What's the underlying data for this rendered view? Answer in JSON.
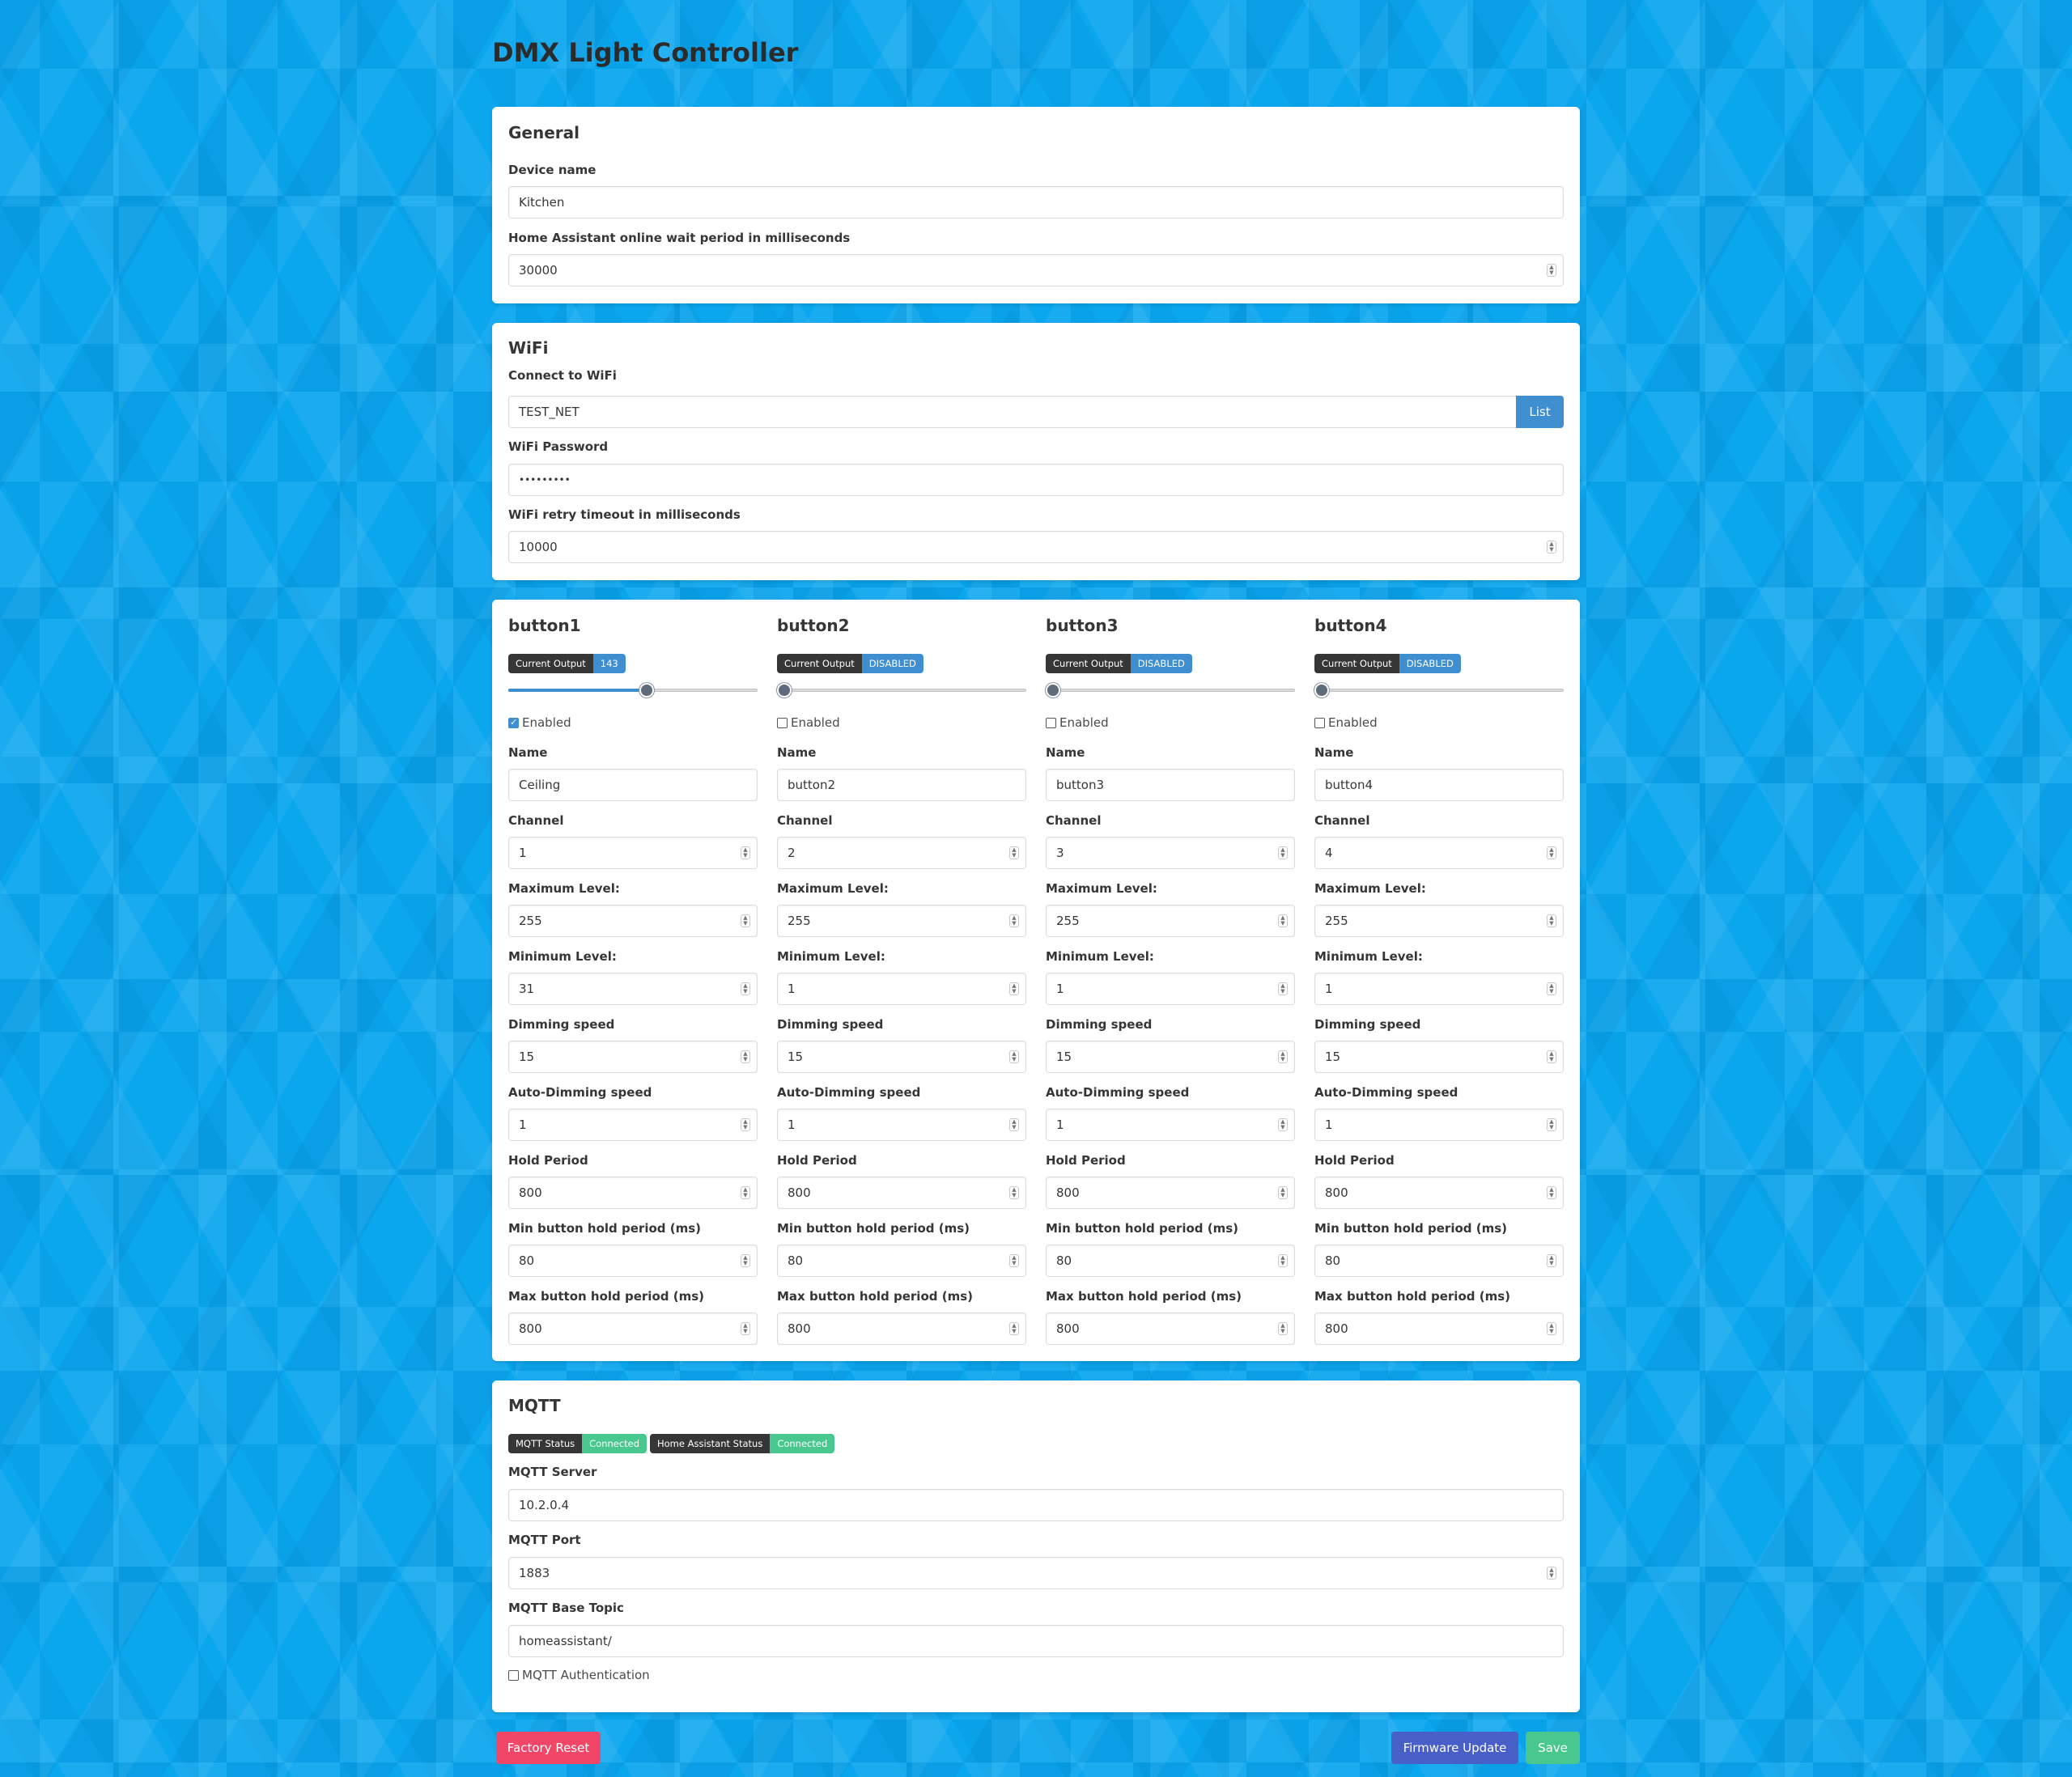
{
  "page_title": "DMX Light Controller",
  "general": {
    "title": "General",
    "device_name_label": "Device name",
    "device_name_value": "Kitchen",
    "ha_wait_label": "Home Assistant online wait period in milliseconds",
    "ha_wait_value": "30000"
  },
  "wifi": {
    "title": "WiFi",
    "connect_label": "Connect to WiFi",
    "ssid_value": "TEST_NET",
    "list_button": "List",
    "password_label": "WiFi Password",
    "password_value": "•••••••••",
    "retry_label": "WiFi retry timeout in milliseconds",
    "retry_value": "10000"
  },
  "field_labels": {
    "output_tag": "Current Output",
    "enabled": "Enabled",
    "name": "Name",
    "channel": "Channel",
    "max_level": "Maximum Level:",
    "min_level": "Minimum Level:",
    "dimming_speed": "Dimming speed",
    "auto_dimming_speed": "Auto-Dimming speed",
    "hold_period": "Hold Period",
    "min_hold": "Min button hold period (ms)",
    "max_hold": "Max button hold period (ms)"
  },
  "buttons": [
    {
      "title": "button1",
      "output": "143",
      "level": 0.56,
      "enabled": true,
      "name": "Ceiling",
      "channel": "1",
      "max_level": "255",
      "min_level": "31",
      "dimming_speed": "15",
      "auto_dimming_speed": "1",
      "hold_period": "800",
      "min_hold": "80",
      "max_hold": "800"
    },
    {
      "title": "button2",
      "output": "DISABLED",
      "level": 0,
      "enabled": false,
      "name": "button2",
      "channel": "2",
      "max_level": "255",
      "min_level": "1",
      "dimming_speed": "15",
      "auto_dimming_speed": "1",
      "hold_period": "800",
      "min_hold": "80",
      "max_hold": "800"
    },
    {
      "title": "button3",
      "output": "DISABLED",
      "level": 0,
      "enabled": false,
      "name": "button3",
      "channel": "3",
      "max_level": "255",
      "min_level": "1",
      "dimming_speed": "15",
      "auto_dimming_speed": "1",
      "hold_period": "800",
      "min_hold": "80",
      "max_hold": "800"
    },
    {
      "title": "button4",
      "output": "DISABLED",
      "level": 0,
      "enabled": false,
      "name": "button4",
      "channel": "4",
      "max_level": "255",
      "min_level": "1",
      "dimming_speed": "15",
      "auto_dimming_speed": "1",
      "hold_period": "800",
      "min_hold": "80",
      "max_hold": "800"
    }
  ],
  "mqtt": {
    "title": "MQTT",
    "status_label": "MQTT Status",
    "status_value": "Connected",
    "ha_status_label": "Home Assistant Status",
    "ha_status_value": "Connected",
    "server_label": "MQTT Server",
    "server_value": "10.2.0.4",
    "port_label": "MQTT Port",
    "port_value": "1883",
    "topic_label": "MQTT Base Topic",
    "topic_value": "homeassistant/",
    "auth_label": "MQTT Authentication"
  },
  "actions": {
    "factory_reset": "Factory Reset",
    "firmware_update": "Firmware Update",
    "save": "Save"
  },
  "colors": {
    "background": "#0aa6ee",
    "info": "#3e8ed0",
    "success": "#48c78e",
    "danger": "#f14668",
    "link": "#485fc7",
    "dark": "#363636"
  }
}
